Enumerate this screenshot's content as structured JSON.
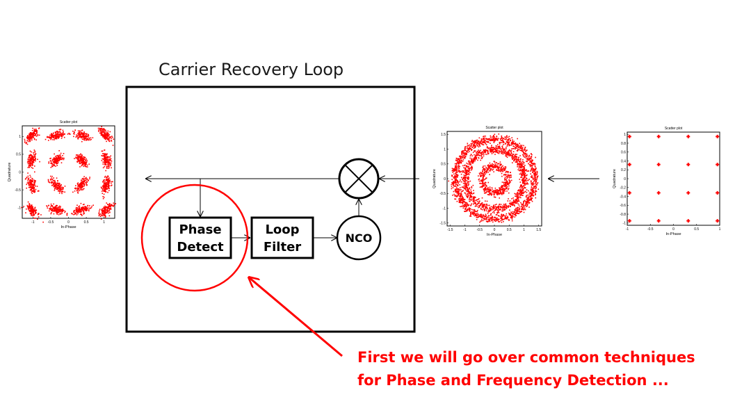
{
  "diagram": {
    "title": "Carrier Recovery Loop",
    "blocks": {
      "phase_detect": [
        "Phase",
        "Detect"
      ],
      "loop_filter": [
        "Loop",
        "Filter"
      ],
      "nco": "NCO",
      "mixer": "multiplier"
    },
    "annotation": {
      "line1": "First we will go over common techniques",
      "line2": "for Phase and Frequency Detection ...",
      "color": "#ff0000"
    }
  },
  "scatter_plots": [
    {
      "id": "input-rotated",
      "title": "Scatter plot",
      "xlabel": "In-Phase",
      "ylabel": "Quadrature",
      "xticks": [
        "-1",
        "-0.5",
        "0",
        "0.5",
        "1"
      ],
      "yticks": [
        "1",
        "0.5",
        "0",
        "-0.5",
        "-1"
      ],
      "description": "16-QAM with phase offset (smeared clusters)",
      "color": "#ff0000"
    },
    {
      "id": "frequency-offset",
      "title": "Scatter plot",
      "xlabel": "In-Phase",
      "ylabel": "Quadrature",
      "xticks": [
        "-1.5",
        "-1",
        "-0.5",
        "0",
        "0.5",
        "1",
        "1.5"
      ],
      "yticks": [
        "1.5",
        "1",
        "0.5",
        "0",
        "-0.5",
        "-1",
        "-1.5"
      ],
      "description": "16-QAM with frequency offset (rings)",
      "color": "#ff0000"
    },
    {
      "id": "ideal",
      "title": "Scatter plot",
      "xlabel": "In-Phase",
      "ylabel": "Quadrature",
      "xticks": [
        "-1",
        "-0.5",
        "0",
        "0.5",
        "1"
      ],
      "yticks": [
        "1",
        "0.8",
        "0.6",
        "0.4",
        "0.2",
        "0",
        "-0.2",
        "-0.4",
        "-0.6",
        "-0.8",
        "-1"
      ],
      "description": "Ideal 16-QAM constellation",
      "color": "#ff0000"
    }
  ]
}
